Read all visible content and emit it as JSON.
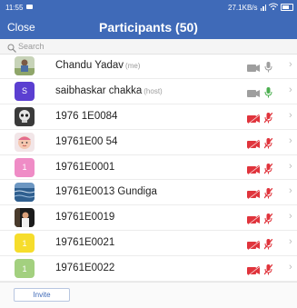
{
  "status_bar": {
    "time": "11:55",
    "network_speed": "27.1KB/s"
  },
  "header": {
    "close_label": "Close",
    "title": "Participants (50)"
  },
  "search": {
    "placeholder": "Search"
  },
  "participants": [
    {
      "name": "Chandu Yadav",
      "tag": "(me)",
      "avatar": "photo-outdoor",
      "video": "off",
      "audio": "idle"
    },
    {
      "name": "saibhaskar chakka",
      "tag": "(host)",
      "avatar": "letter",
      "avatar_letter": "S",
      "avatar_color": "#5b3fd1",
      "video": "off",
      "audio": "active"
    },
    {
      "name": "1976 1E0084",
      "tag": "",
      "avatar": "photo-skull",
      "video": "muted",
      "audio": "muted"
    },
    {
      "name": "19761E00 54",
      "tag": "",
      "avatar": "photo-baby",
      "video": "muted",
      "audio": "muted"
    },
    {
      "name": "19761E0001",
      "tag": "",
      "avatar": "letter",
      "avatar_letter": "1",
      "avatar_color": "#ef8cc6",
      "video": "muted",
      "audio": "muted"
    },
    {
      "name": "19761E0013 Gundiga",
      "tag": "",
      "avatar": "photo-water",
      "video": "muted",
      "audio": "muted"
    },
    {
      "name": "19761E0019",
      "tag": "",
      "avatar": "photo-dark",
      "video": "muted",
      "audio": "muted"
    },
    {
      "name": "19761E0021",
      "tag": "",
      "avatar": "letter",
      "avatar_letter": "1",
      "avatar_color": "#f6dd2c",
      "video": "muted",
      "audio": "muted"
    },
    {
      "name": "19761E0022",
      "tag": "",
      "avatar": "letter",
      "avatar_letter": "1",
      "avatar_color": "#a3d07f",
      "video": "muted",
      "audio": "muted"
    }
  ],
  "footer": {
    "invite_label": "Invite"
  },
  "colors": {
    "header": "#3f6ab8",
    "muted": "#e0343c",
    "active": "#4caf50",
    "idle": "#9e9e9e"
  }
}
